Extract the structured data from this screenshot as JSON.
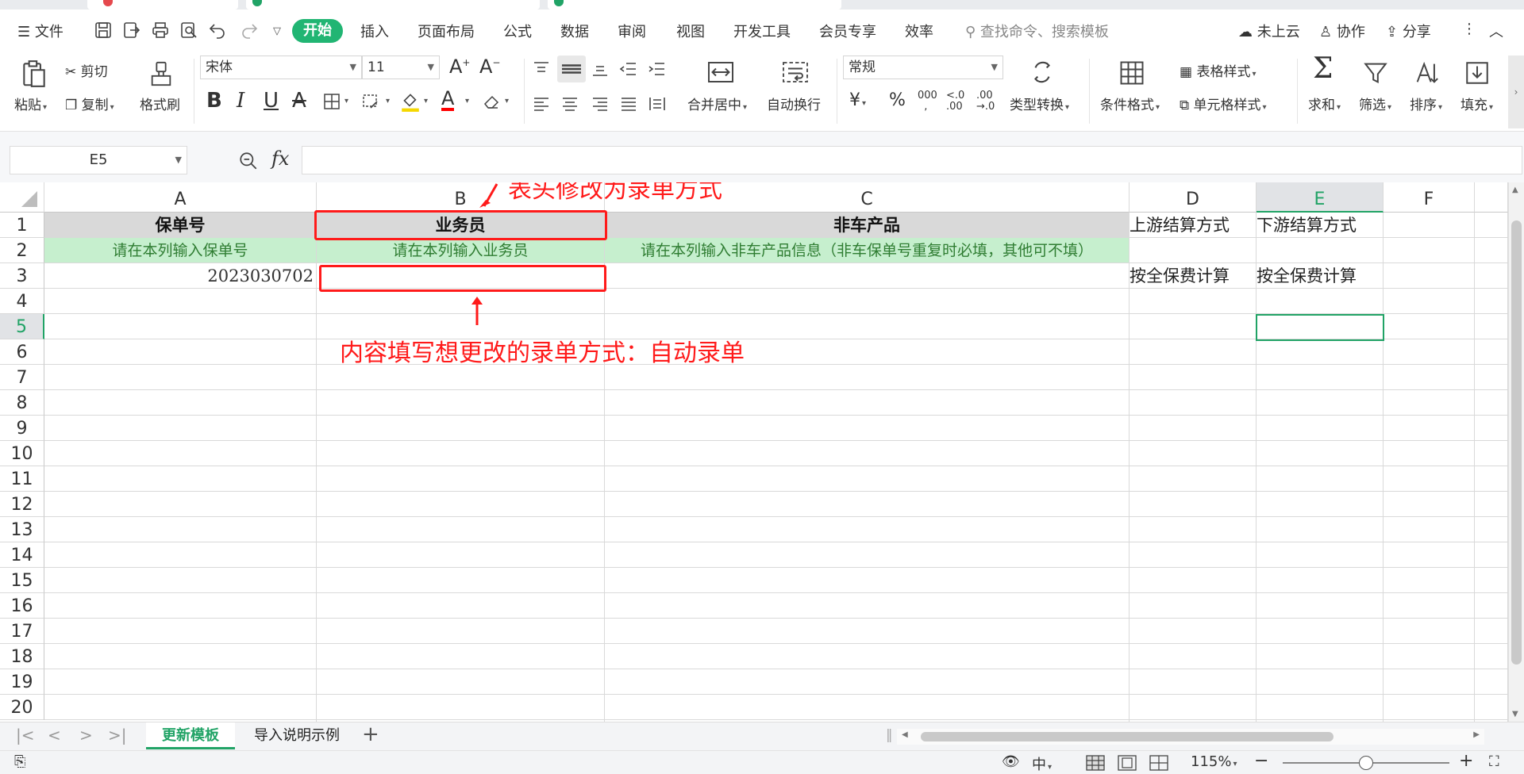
{
  "menu": {
    "file": "文件",
    "tabs": [
      "开始",
      "插入",
      "页面布局",
      "公式",
      "数据",
      "审阅",
      "视图",
      "开发工具",
      "会员专享",
      "效率"
    ],
    "search_placeholder": "查找命令、搜索模板",
    "cloud": "未上云",
    "collab": "协作",
    "share": "分享"
  },
  "ribbon": {
    "paste": "粘贴",
    "cut": "剪切",
    "copy": "复制",
    "format_painter": "格式刷",
    "font_name": "宋体",
    "font_size": "11",
    "merge_center": "合并居中",
    "wrap_text": "自动换行",
    "number_format": "常规",
    "type_convert": "类型转换",
    "cond_format": "条件格式",
    "table_style": "表格样式",
    "cell_style": "单元格样式",
    "sum": "求和",
    "filter": "筛选",
    "sort": "排序",
    "fill": "填充",
    "font_color": "#ff0000",
    "fill_color": "#f5d800"
  },
  "formula_bar": {
    "cell_ref": "E5",
    "fx": "fx"
  },
  "grid": {
    "columns": [
      "A",
      "B",
      "C",
      "D",
      "E",
      "F"
    ],
    "rows": [
      "1",
      "2",
      "3",
      "4",
      "5",
      "6",
      "7",
      "8",
      "9",
      "10",
      "11",
      "12",
      "13",
      "14",
      "15",
      "16",
      "17",
      "18",
      "19",
      "20"
    ],
    "r1": {
      "a": "保单号",
      "b": "业务员",
      "c": "非车产品",
      "d": "上游结算方式",
      "e": "下游结算方式"
    },
    "r2": {
      "a": "请在本列输入保单号",
      "b": "请在本列输入业务员",
      "c": "请在本列输入非车产品信息（非车保单号重复时必填，其他可不填）"
    },
    "r3": {
      "a": "2023030702",
      "d": "按全保费计算",
      "e": "按全保费计算"
    }
  },
  "annotations": {
    "top": "表头修改为录单方式",
    "bottom": "内容填写想更改的录单方式：自动录单",
    "color": "#ff1a1a"
  },
  "sheets": [
    "更新模板",
    "导入说明示例"
  ],
  "status": {
    "zoom": "115%"
  },
  "colors": {
    "accent": "#21a366",
    "header_fill": "#d9d9d9",
    "hint_fill": "#c6efce"
  }
}
